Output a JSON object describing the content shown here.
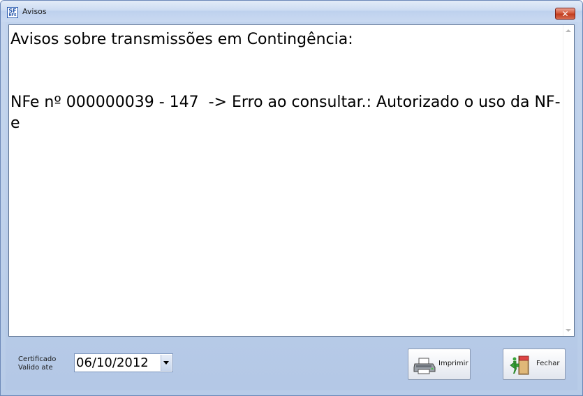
{
  "window": {
    "title": "Avisos",
    "app_icon_top": "SF",
    "app_icon_bottom": "NFE",
    "close_symbol": "✕"
  },
  "memo": {
    "text": "Avisos sobre transmissões em Contingência:\n\n\nNFe nº 000000039 - 147  -> Erro ao consultar.: Autorizado o uso da NF-e"
  },
  "footer": {
    "cert_label_line1": "Certificado",
    "cert_label_line2": "Valido ate",
    "date_value": "06/10/2012",
    "print_label": "Imprimir",
    "close_label": "Fechar",
    "print_icon": "printer-icon",
    "close_icon": "exit-door-icon"
  }
}
